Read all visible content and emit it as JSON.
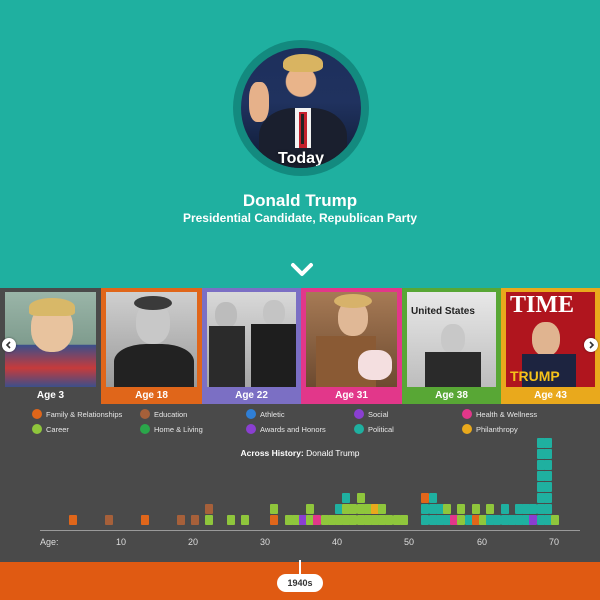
{
  "hero": {
    "portrait_label": "Today",
    "name": "Donald Trump",
    "subtitle": "Presidential Candidate, Republican Party",
    "bg_color": "#1fb0a0",
    "scroll_icon": "chevron-down-icon"
  },
  "carousel": {
    "cards": [
      {
        "caption": "Age 3",
        "color": "#4a4a4a"
      },
      {
        "caption": "Age 18",
        "color": "#e0661a"
      },
      {
        "caption": "Age 22",
        "color": "#7b6fc4"
      },
      {
        "caption": "Age 31",
        "color": "#e2378a"
      },
      {
        "caption": "Age 38",
        "color": "#58a735"
      },
      {
        "caption": "Age 43",
        "color": "#e9a91c"
      }
    ],
    "time_cover_text": "TIME",
    "time_cover_name": "TRUMP",
    "newsprint_text": "United States"
  },
  "legend": {
    "items": [
      {
        "label": "Family & Relationships",
        "color": "#e0661a"
      },
      {
        "label": "Education",
        "color": "#a6603a"
      },
      {
        "label": "Athletic",
        "color": "#2f7fd6"
      },
      {
        "label": "Social",
        "color": "#8a3fd1"
      },
      {
        "label": "Health & Wellness",
        "color": "#e2378a"
      },
      {
        "label": "Career",
        "color": "#8fc63c"
      },
      {
        "label": "Home & Living",
        "color": "#2aa64a"
      },
      {
        "label": "Awards and Honors",
        "color": "#8a3fd1"
      },
      {
        "label": "Political",
        "color": "#1fb0a0"
      },
      {
        "label": "Philanthropy",
        "color": "#e9a91c"
      }
    ]
  },
  "timeline": {
    "title_prefix": "Across History:",
    "title_name": "Donald Trump",
    "axis_label": "Age:",
    "ticks": [
      "10",
      "20",
      "30",
      "40",
      "50",
      "60",
      "70"
    ],
    "decade": "1940s"
  },
  "chart_data": {
    "type": "bar",
    "title": "Across History: Donald Trump",
    "xlabel": "Age:",
    "series_note": "stacked event counts per age, colored by category",
    "bars": [
      {
        "age": 3,
        "stack": [
          "#e0661a"
        ]
      },
      {
        "age": 8,
        "stack": [
          "#a6603a"
        ]
      },
      {
        "age": 13,
        "stack": [
          "#e0661a"
        ]
      },
      {
        "age": 18,
        "stack": [
          "#a6603a"
        ]
      },
      {
        "age": 20,
        "stack": [
          "#a6603a"
        ]
      },
      {
        "age": 22,
        "stack": [
          "#8fc63c",
          "#a6603a"
        ]
      },
      {
        "age": 25,
        "stack": [
          "#8fc63c"
        ]
      },
      {
        "age": 27,
        "stack": [
          "#8fc63c"
        ]
      },
      {
        "age": 31,
        "stack": [
          "#e0661a",
          "#8fc63c"
        ]
      },
      {
        "age": 33,
        "stack": [
          "#8fc63c"
        ]
      },
      {
        "age": 34,
        "stack": [
          "#8fc63c"
        ]
      },
      {
        "age": 35,
        "stack": [
          "#8a3fd1"
        ]
      },
      {
        "age": 36,
        "stack": [
          "#8fc63c",
          "#8fc63c"
        ]
      },
      {
        "age": 37,
        "stack": [
          "#e2378a"
        ]
      },
      {
        "age": 38,
        "stack": [
          "#8fc63c"
        ]
      },
      {
        "age": 39,
        "stack": [
          "#8fc63c"
        ]
      },
      {
        "age": 40,
        "stack": [
          "#8fc63c",
          "#1fb0a0"
        ]
      },
      {
        "age": 41,
        "stack": [
          "#8fc63c",
          "#8fc63c",
          "#1fb0a0"
        ]
      },
      {
        "age": 42,
        "stack": [
          "#8fc63c",
          "#8fc63c"
        ]
      },
      {
        "age": 43,
        "stack": [
          "#8fc63c",
          "#8fc63c",
          "#8fc63c"
        ]
      },
      {
        "age": 44,
        "stack": [
          "#8fc63c",
          "#8fc63c"
        ]
      },
      {
        "age": 45,
        "stack": [
          "#8fc63c",
          "#e9a91c"
        ]
      },
      {
        "age": 46,
        "stack": [
          "#8fc63c",
          "#8fc63c"
        ]
      },
      {
        "age": 47,
        "stack": [
          "#8fc63c"
        ]
      },
      {
        "age": 48,
        "stack": [
          "#8fc63c"
        ]
      },
      {
        "age": 49,
        "stack": [
          "#8fc63c"
        ]
      },
      {
        "age": 52,
        "stack": [
          "#1fb0a0",
          "#1fb0a0",
          "#e0661a"
        ]
      },
      {
        "age": 53,
        "stack": [
          "#1fb0a0",
          "#1fb0a0",
          "#1fb0a0"
        ]
      },
      {
        "age": 54,
        "stack": [
          "#1fb0a0",
          "#1fb0a0"
        ]
      },
      {
        "age": 55,
        "stack": [
          "#1fb0a0",
          "#8fc63c"
        ]
      },
      {
        "age": 56,
        "stack": [
          "#e2378a"
        ]
      },
      {
        "age": 57,
        "stack": [
          "#8fc63c",
          "#8fc63c"
        ]
      },
      {
        "age": 58,
        "stack": [
          "#1fb0a0"
        ]
      },
      {
        "age": 59,
        "stack": [
          "#e0661a",
          "#8fc63c"
        ]
      },
      {
        "age": 60,
        "stack": [
          "#8fc63c"
        ]
      },
      {
        "age": 61,
        "stack": [
          "#1fb0a0",
          "#8fc63c"
        ]
      },
      {
        "age": 62,
        "stack": [
          "#1fb0a0"
        ]
      },
      {
        "age": 63,
        "stack": [
          "#1fb0a0",
          "#1fb0a0"
        ]
      },
      {
        "age": 64,
        "stack": [
          "#1fb0a0"
        ]
      },
      {
        "age": 65,
        "stack": [
          "#1fb0a0",
          "#1fb0a0"
        ]
      },
      {
        "age": 66,
        "stack": [
          "#1fb0a0",
          "#1fb0a0"
        ]
      },
      {
        "age": 67,
        "stack": [
          "#8a3fd1",
          "#1fb0a0"
        ]
      },
      {
        "age": 68,
        "stack": [
          "#1fb0a0",
          "#1fb0a0",
          "#1fb0a0",
          "#1fb0a0",
          "#1fb0a0",
          "#1fb0a0",
          "#1fb0a0",
          "#1fb0a0"
        ]
      },
      {
        "age": 69,
        "stack": [
          "#1fb0a0",
          "#1fb0a0",
          "#1fb0a0",
          "#1fb0a0",
          "#1fb0a0",
          "#1fb0a0",
          "#1fb0a0",
          "#1fb0a0"
        ]
      },
      {
        "age": 70,
        "stack": [
          "#8fc63c"
        ]
      }
    ]
  }
}
